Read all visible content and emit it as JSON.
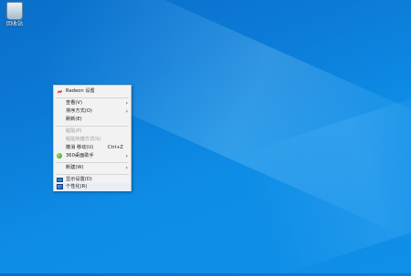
{
  "desktop": {
    "icon_label": "回收站"
  },
  "context_menu": {
    "items": [
      {
        "label": "Radeon 设置",
        "icon": "radeon-icon",
        "disabled": false
      },
      {
        "label": "查看(V)",
        "submenu": true
      },
      {
        "label": "排序方式(O)",
        "submenu": true
      },
      {
        "label": "刷新(E)"
      },
      {
        "label": "粘贴(P)",
        "disabled": true
      },
      {
        "label": "粘贴快捷方式(S)",
        "disabled": true
      },
      {
        "label": "撤消 移动(U)",
        "shortcut": "Ctrl+Z"
      },
      {
        "label": "360桌面助手",
        "icon": "360-icon",
        "submenu": true
      },
      {
        "label": "新建(W)",
        "submenu": true
      },
      {
        "label": "显示设置(D)",
        "icon": "display-icon"
      },
      {
        "label": "个性化(R)",
        "icon": "personalize-icon"
      }
    ],
    "submenu_arrow": "›"
  },
  "colors": {
    "desktop_bg": "#0b7ad6",
    "menu_bg": "#f2f2f2",
    "disabled_text": "#9a9a9a",
    "hover_bg": "#e6eef8"
  }
}
